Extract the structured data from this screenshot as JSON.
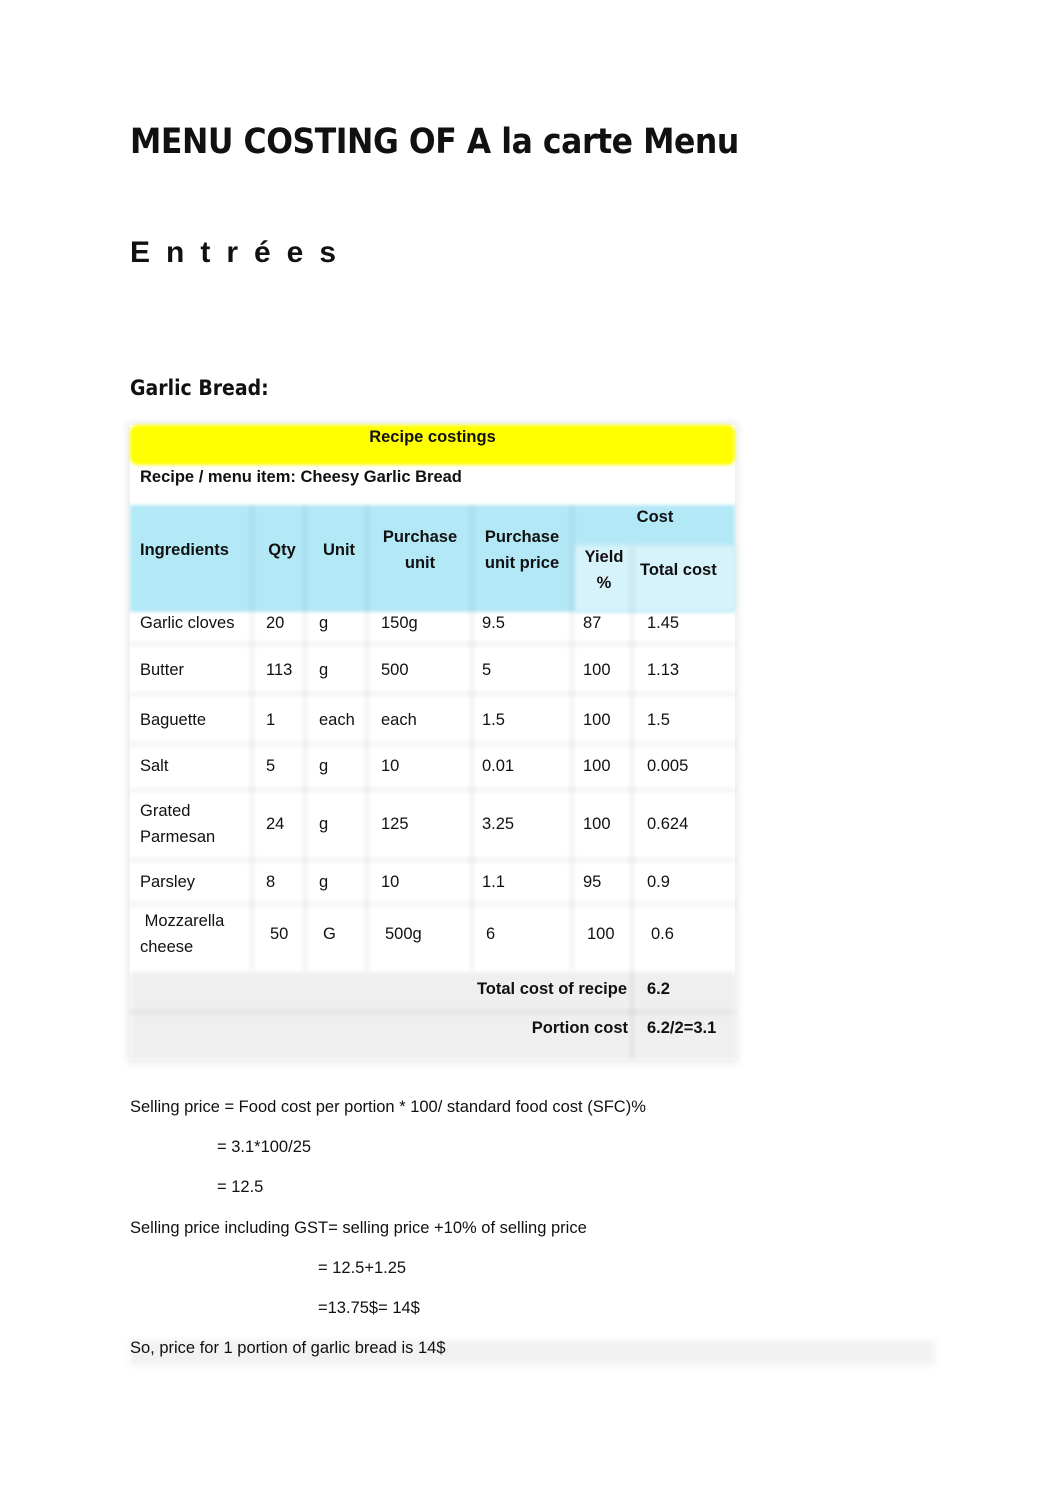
{
  "document": {
    "title": "MENU COSTING OF A la carte Menu",
    "section": "Entrées",
    "dish_heading": "Garlic Bread:"
  },
  "recipe_table": {
    "banner": "Recipe costings",
    "menu_item_label": "Recipe / menu item: Cheesy Garlic Bread",
    "colors": {
      "banner": "#ffff00",
      "header": "#b3e8f7",
      "header_sub": "#d6f2fa",
      "footer": "#efefef"
    },
    "headers": {
      "ingredients": "Ingredients",
      "qty": "Qty",
      "unit": "Unit",
      "purchase_unit_1": "Purchase",
      "purchase_unit_2": "unit",
      "purchase_unit_price_1": "Purchase",
      "purchase_unit_price_2": "unit price",
      "cost_group": "Cost",
      "yield_1": "Yield",
      "yield_2": "%",
      "total_cost": "Total cost"
    },
    "rows": [
      {
        "ingredient": "Garlic cloves",
        "ingredient_l2": "",
        "qty": "20",
        "unit": "g",
        "purchase_unit": "150g",
        "purchase_unit_price": "9.5",
        "yield": "87",
        "total_cost": "1.45"
      },
      {
        "ingredient": "Butter",
        "ingredient_l2": "",
        "qty": "113",
        "unit": "g",
        "purchase_unit": "500",
        "purchase_unit_price": "5",
        "yield": "100",
        "total_cost": "1.13"
      },
      {
        "ingredient": "Baguette",
        "ingredient_l2": "",
        "qty": "1",
        "unit": "each",
        "purchase_unit": "each",
        "purchase_unit_price": "1.5",
        "yield": "100",
        "total_cost": "1.5"
      },
      {
        "ingredient": "Salt",
        "ingredient_l2": "",
        "qty": "5",
        "unit": "g",
        "purchase_unit": "10",
        "purchase_unit_price": "0.01",
        "yield": "100",
        "total_cost": "0.005"
      },
      {
        "ingredient": "Grated",
        "ingredient_l2": "Parmesan",
        "qty": "24",
        "unit": "g",
        "purchase_unit": "125",
        "purchase_unit_price": "3.25",
        "yield": "100",
        "total_cost": "0.624"
      },
      {
        "ingredient": "Parsley",
        "ingredient_l2": "",
        "qty": "8",
        "unit": "g",
        "purchase_unit": "10",
        "purchase_unit_price": "1.1",
        "yield": "95",
        "total_cost": "0.9"
      },
      {
        "ingredient": " Mozzarella",
        "ingredient_l2": "cheese",
        "qty": "50",
        "unit": "G",
        "purchase_unit": "500g",
        "purchase_unit_price": "6",
        "yield": "100",
        "total_cost": "0.6"
      }
    ],
    "total_cost_label": "Total cost of recipe",
    "total_cost_value": "6.2",
    "portion_cost_label": "Portion cost",
    "portion_cost_value": "6.2/2=3.1"
  },
  "calculation": {
    "selling_price_formula": "Selling price = Food cost per portion * 100/ standard food cost (SFC)%",
    "selling_price_step1": "= 3.1*100/25",
    "selling_price_step2": "= 12.5",
    "gst_formula": "Selling price including GST= selling price +10% of selling price",
    "gst_step1": "= 12.5+1.25",
    "gst_step2": "=13.75$= 14$",
    "conclusion": "So, price for 1 portion of garlic bread is 14$"
  }
}
